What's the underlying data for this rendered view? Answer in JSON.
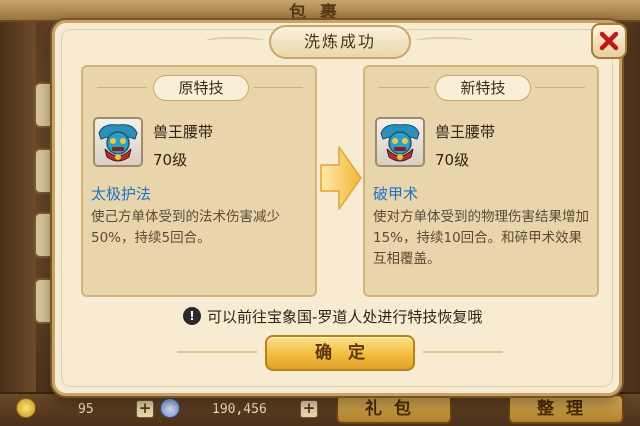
{
  "background": {
    "title": "包裹",
    "coins": "95",
    "gems": "190,456",
    "gift_button": "礼包",
    "sort_button": "整理"
  },
  "dialog": {
    "title": "洗炼成功",
    "old_panel": {
      "header": "原特技",
      "item_name": "兽王腰带",
      "item_level": "70级",
      "skill_name": "太极护法",
      "skill_desc": "使己方单体受到的法术伤害减少50%，持续5回合。"
    },
    "new_panel": {
      "header": "新特技",
      "item_name": "兽王腰带",
      "item_level": "70级",
      "skill_name": "破甲术",
      "skill_desc": "使对方单体受到的物理伤害结果增加15%，持续10回合。和碎甲术效果互相覆盖。"
    },
    "hint": "可以前往宝象国-罗道人处进行特技恢复哦",
    "confirm_label": "确定"
  },
  "icons": {
    "close": "close-x-icon",
    "arrow": "right-arrow-icon",
    "hint": "exclamation-icon",
    "item": "beast-king-belt-icon",
    "coin": "coin-icon",
    "gem": "gem-icon"
  },
  "colors": {
    "skill_name": "#1f72c8",
    "close_x": "#c0181a",
    "confirm": "#f0b93a"
  }
}
